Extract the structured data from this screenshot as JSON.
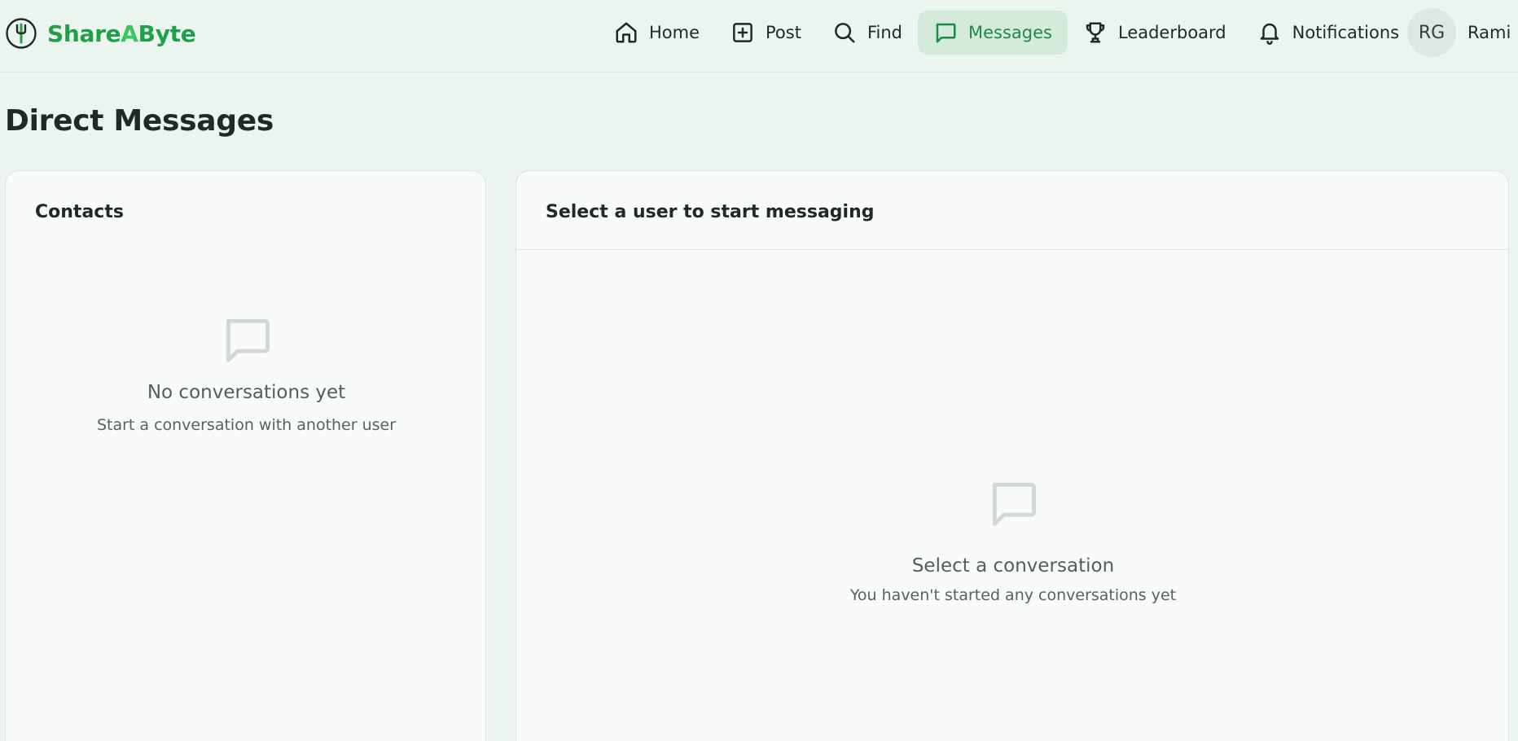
{
  "brand": {
    "name_part1": "Share",
    "name_part2": "A",
    "name_part3": "Byte",
    "logo_icon": "fork-logo-icon",
    "accent": "#21a04a"
  },
  "nav": {
    "items": [
      {
        "label": "Home",
        "icon": "home-icon"
      },
      {
        "label": "Post",
        "icon": "plus-square-icon"
      },
      {
        "label": "Find",
        "icon": "search-icon"
      },
      {
        "label": "Messages",
        "icon": "message-icon",
        "active": true
      },
      {
        "label": "Leaderboard",
        "icon": "trophy-icon"
      },
      {
        "label": "Notifications",
        "icon": "bell-icon"
      }
    ],
    "active_color": "#1f8a44",
    "active_bg": "#d4eadb"
  },
  "user": {
    "initials": "RG",
    "name": "Rami"
  },
  "page": {
    "title": "Direct Messages"
  },
  "contacts": {
    "title": "Contacts",
    "empty_title": "No conversations yet",
    "empty_subtitle": "Start a conversation with another user"
  },
  "chat": {
    "title": "Select a user to start messaging",
    "empty_title": "Select a conversation",
    "empty_subtitle": "You haven't started any conversations yet"
  }
}
